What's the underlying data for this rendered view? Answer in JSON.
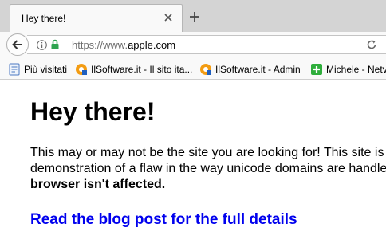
{
  "browser": {
    "tab": {
      "title": "Hey there!"
    },
    "address_bar": {
      "scheme": "https://www.",
      "host": "apple.com"
    },
    "bookmarks": [
      {
        "label": "Più visitati",
        "icon": "page-icon"
      },
      {
        "label": "IlSoftware.it - Il sito ita...",
        "icon": "ilsoftware-favicon"
      },
      {
        "label": "IlSoftware.it - Admin",
        "icon": "ilsoftware-favicon"
      },
      {
        "label": "Michele - Netv",
        "icon": "green-plus-icon"
      }
    ]
  },
  "page": {
    "heading": "Hey there!",
    "paragraph": {
      "line1": "This may or may not be the site you are looking for! This site is",
      "line2": "demonstration of a flaw in the way unicode domains are handle",
      "line3_bold": "browser isn't affected."
    },
    "link": "Read the blog post for the full details"
  },
  "colors": {
    "link": "#0000ee",
    "lock": "#2ea44f",
    "tabstrip": "#d4d4d4"
  }
}
